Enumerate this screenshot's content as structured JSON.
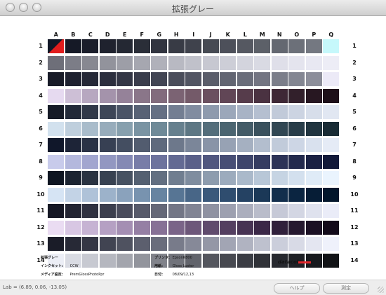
{
  "window": {
    "title": "拡張グレー"
  },
  "chart": {
    "columns": [
      "A",
      "B",
      "C",
      "D",
      "E",
      "F",
      "G",
      "H",
      "I",
      "J",
      "K",
      "L",
      "M",
      "N",
      "O",
      "P",
      "Q"
    ],
    "rows": [
      "1",
      "2",
      "3",
      "4",
      "5",
      "6",
      "7",
      "8",
      "9",
      "10",
      "11",
      "12",
      "13",
      "14"
    ],
    "palette": [
      [
        "#111827",
        "#151926",
        "#1a1d2a",
        "#1f222e",
        "#242833",
        "#2a2e38",
        "#31343f",
        "#383b45",
        "#3f424c",
        "#464a53",
        "#4d505a",
        "#555861",
        "#5c6068",
        "#646871",
        "#6c7079",
        "#747881",
        "#c6f8fb"
      ],
      [
        "#6e6f79",
        "#7c7d87",
        "#878891",
        "#92939c",
        "#9d9ea7",
        "#a6a7b0",
        "#b0b1ba",
        "#b8b9c2",
        "#c0c1ca",
        "#c7c8d1",
        "#cdced7",
        "#d3d4dd",
        "#d9dae3",
        "#dfdfe9",
        "#e4e4ee",
        "#e8e8f2",
        "#ededf6"
      ],
      [
        "#181b28",
        "#1e2130",
        "#252837",
        "#2c2f3e",
        "#333645",
        "#3a3d4c",
        "#424554",
        "#4a4d5b",
        "#525563",
        "#5a5d6a",
        "#626572",
        "#6a6d7a",
        "#737582",
        "#7b7e8a",
        "#838692",
        "#8c8e9a",
        "#eceaf7"
      ],
      [
        "#e6daf0",
        "#cdbfd6",
        "#b7a8c0",
        "#a493ab",
        "#958299",
        "#8a7689",
        "#826c7d",
        "#7b6373",
        "#745a69",
        "#6b5060",
        "#614656",
        "#563c4b",
        "#4a3241",
        "#3e2836",
        "#32202b",
        "#271721",
        "#1e1019"
      ],
      [
        "#151a26",
        "#222938",
        "#303848",
        "#3d4657",
        "#4a5466",
        "#586275",
        "#657084",
        "#737e92",
        "#818ca0",
        "#8e9aad",
        "#9ba7ba",
        "#a8b3c5",
        "#b5bfd0",
        "#c1cad9",
        "#ccd4e2",
        "#d7deea",
        "#e1e7f2"
      ],
      [
        "#d2e1ee",
        "#bfcfdd",
        "#a9bccb",
        "#97acbb",
        "#87a0ae",
        "#7a94a3",
        "#6f8a98",
        "#66808e",
        "#5d7784",
        "#546e7b",
        "#4b6571",
        "#435b67",
        "#3a515d",
        "#314753",
        "#283d49",
        "#20343f",
        "#182b35"
      ],
      [
        "#10172a",
        "#1d2437",
        "#2a3245",
        "#374053",
        "#444e61",
        "#525c6f",
        "#5f6a7d",
        "#6d788b",
        "#7b8699",
        "#8994a7",
        "#97a2b4",
        "#a5b0c1",
        "#b3bece",
        "#c1cbda",
        "#cdd6e5",
        "#d9e1ee",
        "#e5ebf6"
      ],
      [
        "#c8cbeb",
        "#b4b8dd",
        "#a2a6cf",
        "#9297c1",
        "#8489b4",
        "#787da8",
        "#6d739d",
        "#636a93",
        "#5a6089",
        "#51577f",
        "#474e75",
        "#3e456b",
        "#353c61",
        "#2c3357",
        "#232a4d",
        "#1a2143",
        "#121939"
      ],
      [
        "#0e1521",
        "#1c2431",
        "#2a3341",
        "#384251",
        "#465161",
        "#546071",
        "#626f81",
        "#707e90",
        "#7f8d9f",
        "#8d9cae",
        "#9cabbd",
        "#aab9ca",
        "#b8c7d7",
        "#c6d4e3",
        "#d3e0ee",
        "#dfebf7",
        "#eaf4fe"
      ],
      [
        "#d6e4f4",
        "#c3d3e6",
        "#afc2d8",
        "#9cb2ca",
        "#8aa2bc",
        "#7893af",
        "#6784a1",
        "#577594",
        "#486687",
        "#3b597b",
        "#2f4d6f",
        "#254263",
        "#1b3857",
        "#122e4c",
        "#0b2541",
        "#061d36",
        "#03162c"
      ],
      [
        "#151724",
        "#222432",
        "#2f3140",
        "#3c3f4e",
        "#4a4c5c",
        "#575a6a",
        "#656878",
        "#737686",
        "#818494",
        "#8f92a2",
        "#9da0b0",
        "#abaebd",
        "#b9bcca",
        "#c6c9d7",
        "#d3d6e3",
        "#dfe2ee",
        "#eaecf8"
      ],
      [
        "#eadcf2",
        "#d8c7e3",
        "#c6b3d3",
        "#b5a0c3",
        "#a48eb3",
        "#957fa4",
        "#877196",
        "#7a6488",
        "#6d577a",
        "#604b6d",
        "#543f60",
        "#473353",
        "#3b2847",
        "#30203b",
        "#25182f",
        "#1b1024",
        "#130a1a"
      ],
      [
        "#1a1c28",
        "#272936",
        "#343644",
        "#414452",
        "#4f5260",
        "#5c5f6e",
        "#6a6d7c",
        "#787b8a",
        "#868998",
        "#9497a6",
        "#a2a5b4",
        "#b0b3c1",
        "#bec1ce",
        "#cbcedb",
        "#d8dae6",
        "#e4e6f1",
        "#eff1fb"
      ],
      [
        "#eceef6",
        "#d9dbe3",
        "#c7c9d1",
        "#b5b7bf",
        "#a3a5ad",
        "#92949c",
        "#81838b",
        "#71737b",
        "#62646c",
        "#54565e",
        "#474950",
        "#3b3d44",
        "#303238",
        "#26282e",
        "#1e2025",
        "#17191d",
        "#111316"
      ]
    ]
  },
  "meta": {
    "left": [
      {
        "key": "拡張グレー",
        "value": ""
      },
      {
        "key": "インクセット:",
        "value": "CCW"
      },
      {
        "key": "メディア設定:",
        "value": "PremGlossPhotoPpr"
      }
    ],
    "right": [
      {
        "key": "プリンタ:",
        "value": "EpsonR800"
      },
      {
        "key": "用紙:",
        "value": "Gloss Luster"
      },
      {
        "key": "日付:",
        "value": "08/09/12,13"
      }
    ],
    "logo": "datacolor"
  },
  "status": {
    "lab_readout": "Lab = (6.89, 0.06, -13.05)"
  },
  "buttons": {
    "help": "ヘルプ",
    "measure": "測定"
  },
  "colors": {
    "logo_accent": "#e3262b",
    "calibration_corner": "#e11d1d"
  }
}
